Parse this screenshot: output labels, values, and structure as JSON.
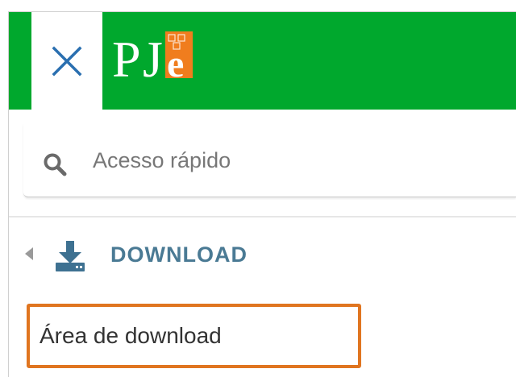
{
  "header": {
    "close_icon": "close-icon",
    "logo": {
      "text_p": "P",
      "text_j": "J",
      "text_e": "e",
      "colors": {
        "header_bg": "#00a82d",
        "logo_letters": "#ffffff",
        "logo_e_box": "#f07d1e"
      }
    }
  },
  "search": {
    "icon": "search-icon",
    "placeholder": "Acesso rápido",
    "value": ""
  },
  "menu": {
    "section": {
      "icon": "download-icon",
      "caret_icon": "caret-left-icon",
      "label": "DOWNLOAD",
      "color": "#4a7a94"
    },
    "items": [
      {
        "label": "Área de download",
        "highlight_color": "#e07520"
      }
    ]
  }
}
